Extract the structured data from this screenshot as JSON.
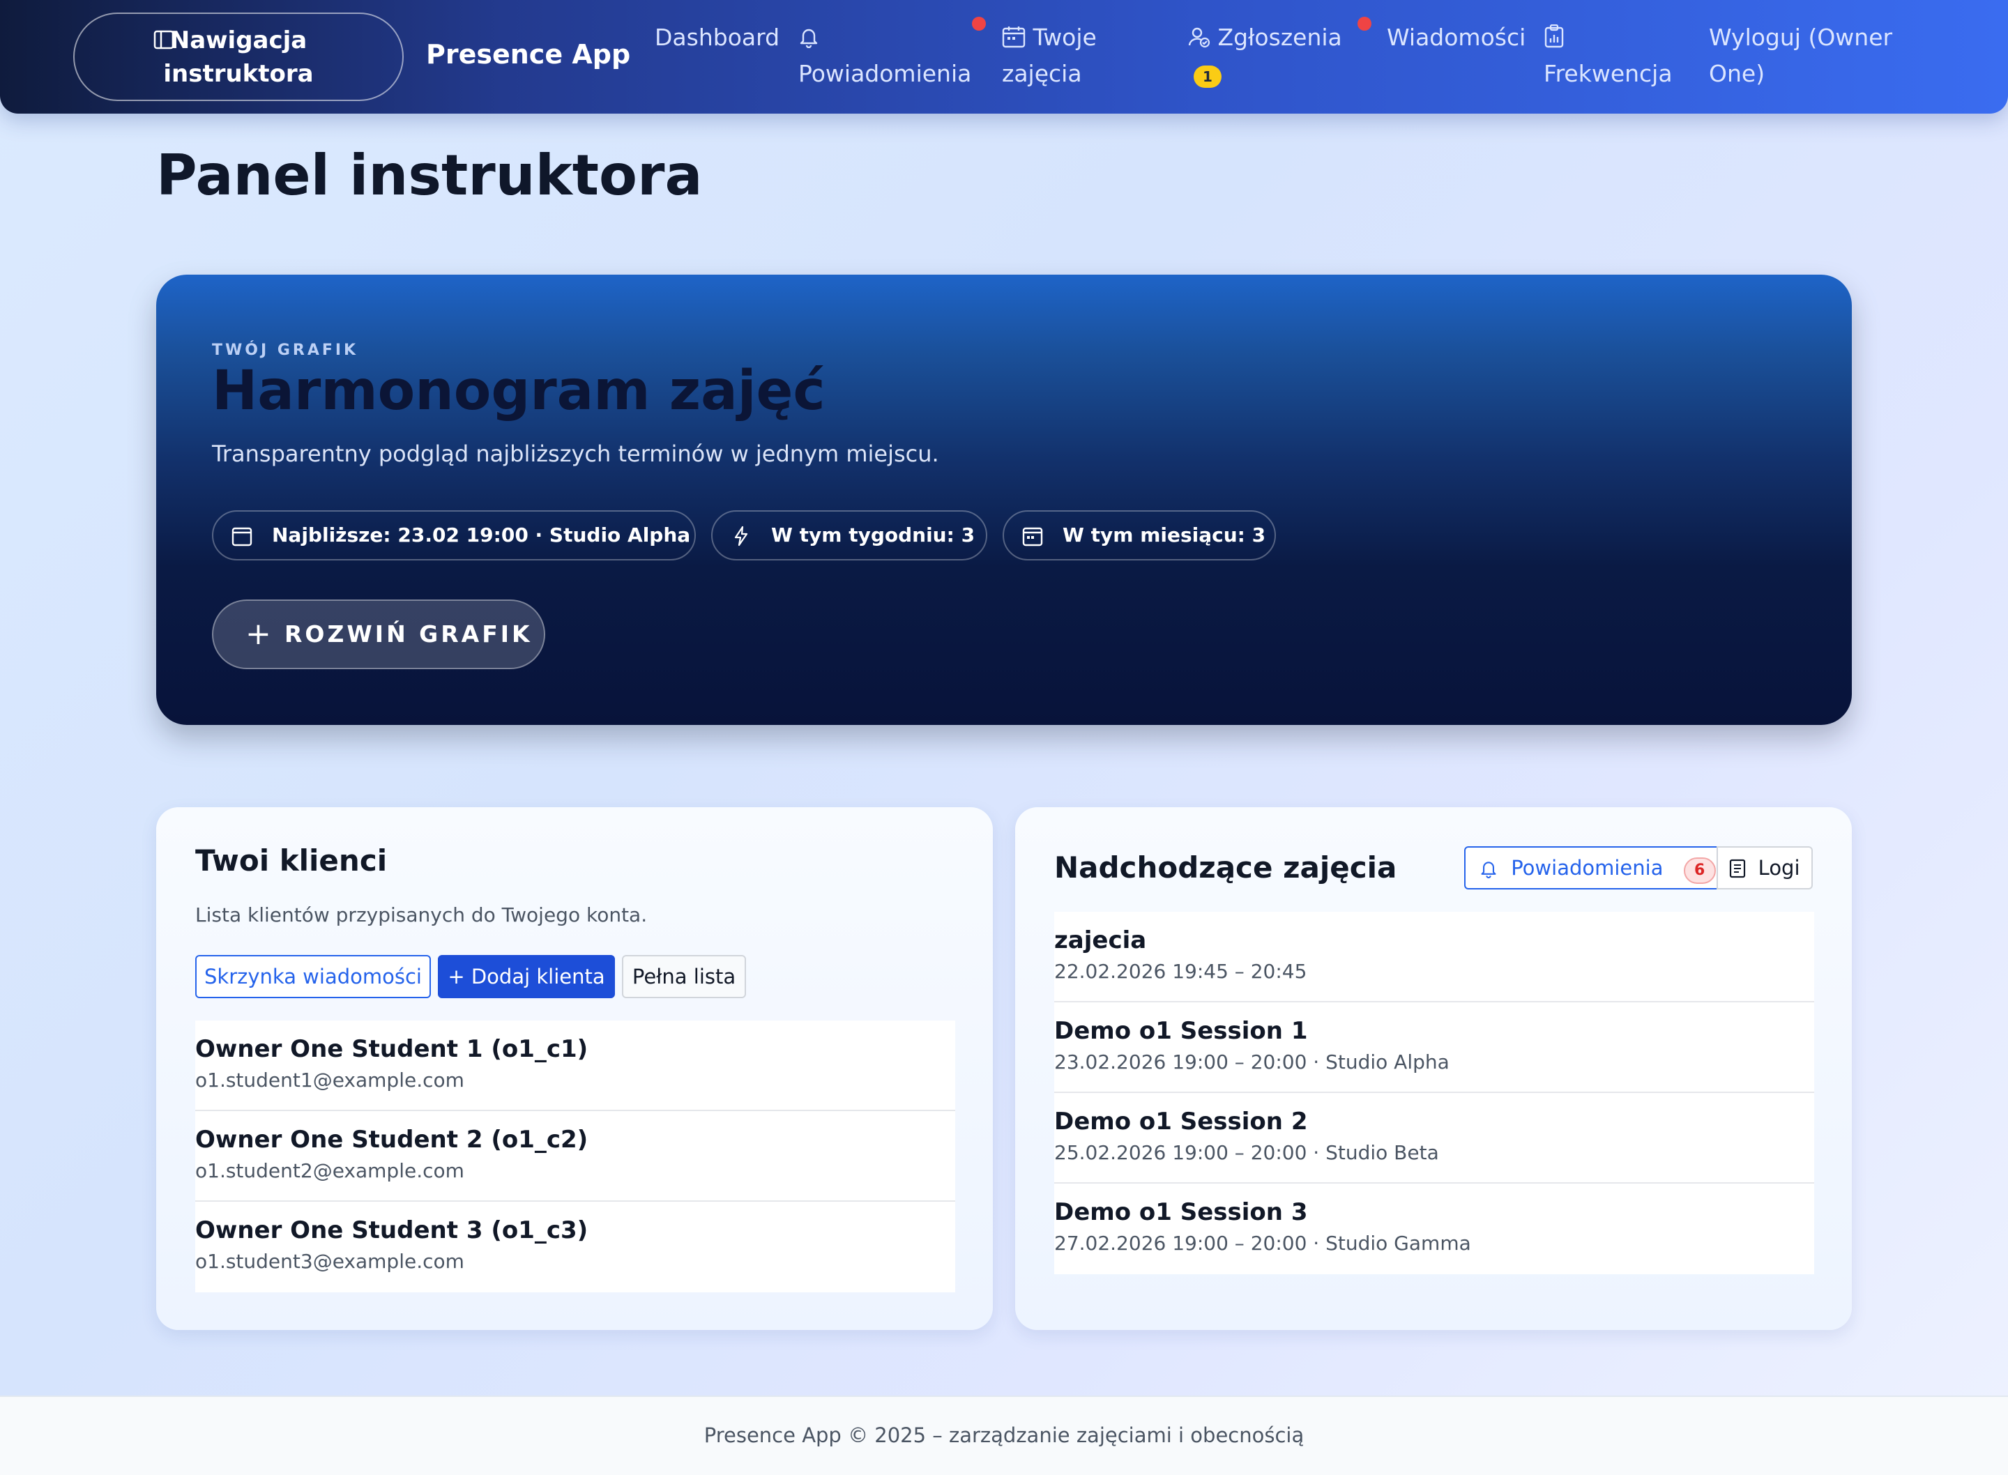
{
  "nav": {
    "toggle_label": "Nawigacja instruktora",
    "brand": "Presence App",
    "items": {
      "dashboard": "Dashboard",
      "notifications": "Powiadomienia",
      "classes": "Twoje zajęcia",
      "requests": "Zgłoszenia",
      "requests_badge": "1",
      "messages": "Wiadomości",
      "attendance": "Frekwencja",
      "logout": "Wyloguj (Owner One)"
    }
  },
  "page": {
    "title": "Panel instruktora"
  },
  "hero": {
    "kicker": "TWÓJ GRAFIK",
    "title": "Harmonogram zajęć",
    "subtitle": "Transparentny podgląd najbliższych terminów w jednym miejscu.",
    "chips": {
      "next": "Najbliższe: 23.02 19:00 · Studio Alpha",
      "week": "W tym tygodniu: 3",
      "month": "W tym miesiącu: 3"
    },
    "expand_button": "ROZWIŃ GRAFIK"
  },
  "clients": {
    "title": "Twoi klienci",
    "description": "Lista klientów przypisanych do Twojego konta.",
    "buttons": {
      "inbox": "Skrzynka wiadomości",
      "add": "+ Dodaj klienta",
      "full_list": "Pełna lista"
    },
    "items": [
      {
        "name": "Owner One Student 1 (o1_c1)",
        "email": "o1.student1@example.com"
      },
      {
        "name": "Owner One Student 2 (o1_c2)",
        "email": "o1.student2@example.com"
      },
      {
        "name": "Owner One Student 3 (o1_c3)",
        "email": "o1.student3@example.com"
      }
    ]
  },
  "upcoming": {
    "title": "Nadchodzące zajęcia",
    "buttons": {
      "notifications": "Powiadomienia",
      "notifications_count": "6",
      "logs": "Logi"
    },
    "items": [
      {
        "title": "zajecia",
        "details": "22.02.2026 19:45 – 20:45"
      },
      {
        "title": "Demo o1 Session 1",
        "details": "23.02.2026 19:00 – 20:00 · Studio Alpha"
      },
      {
        "title": "Demo o1 Session 2",
        "details": "25.02.2026 19:00 – 20:00 · Studio Beta"
      },
      {
        "title": "Demo o1 Session 3",
        "details": "27.02.2026 19:00 – 20:00 · Studio Gamma"
      }
    ]
  },
  "footer": {
    "text": "Presence App © 2025 – zarządzanie zajęciami i obecnością"
  },
  "colors": {
    "accent": "#1d4ed8",
    "badge": "#facc15",
    "alert": "#ef4444"
  }
}
